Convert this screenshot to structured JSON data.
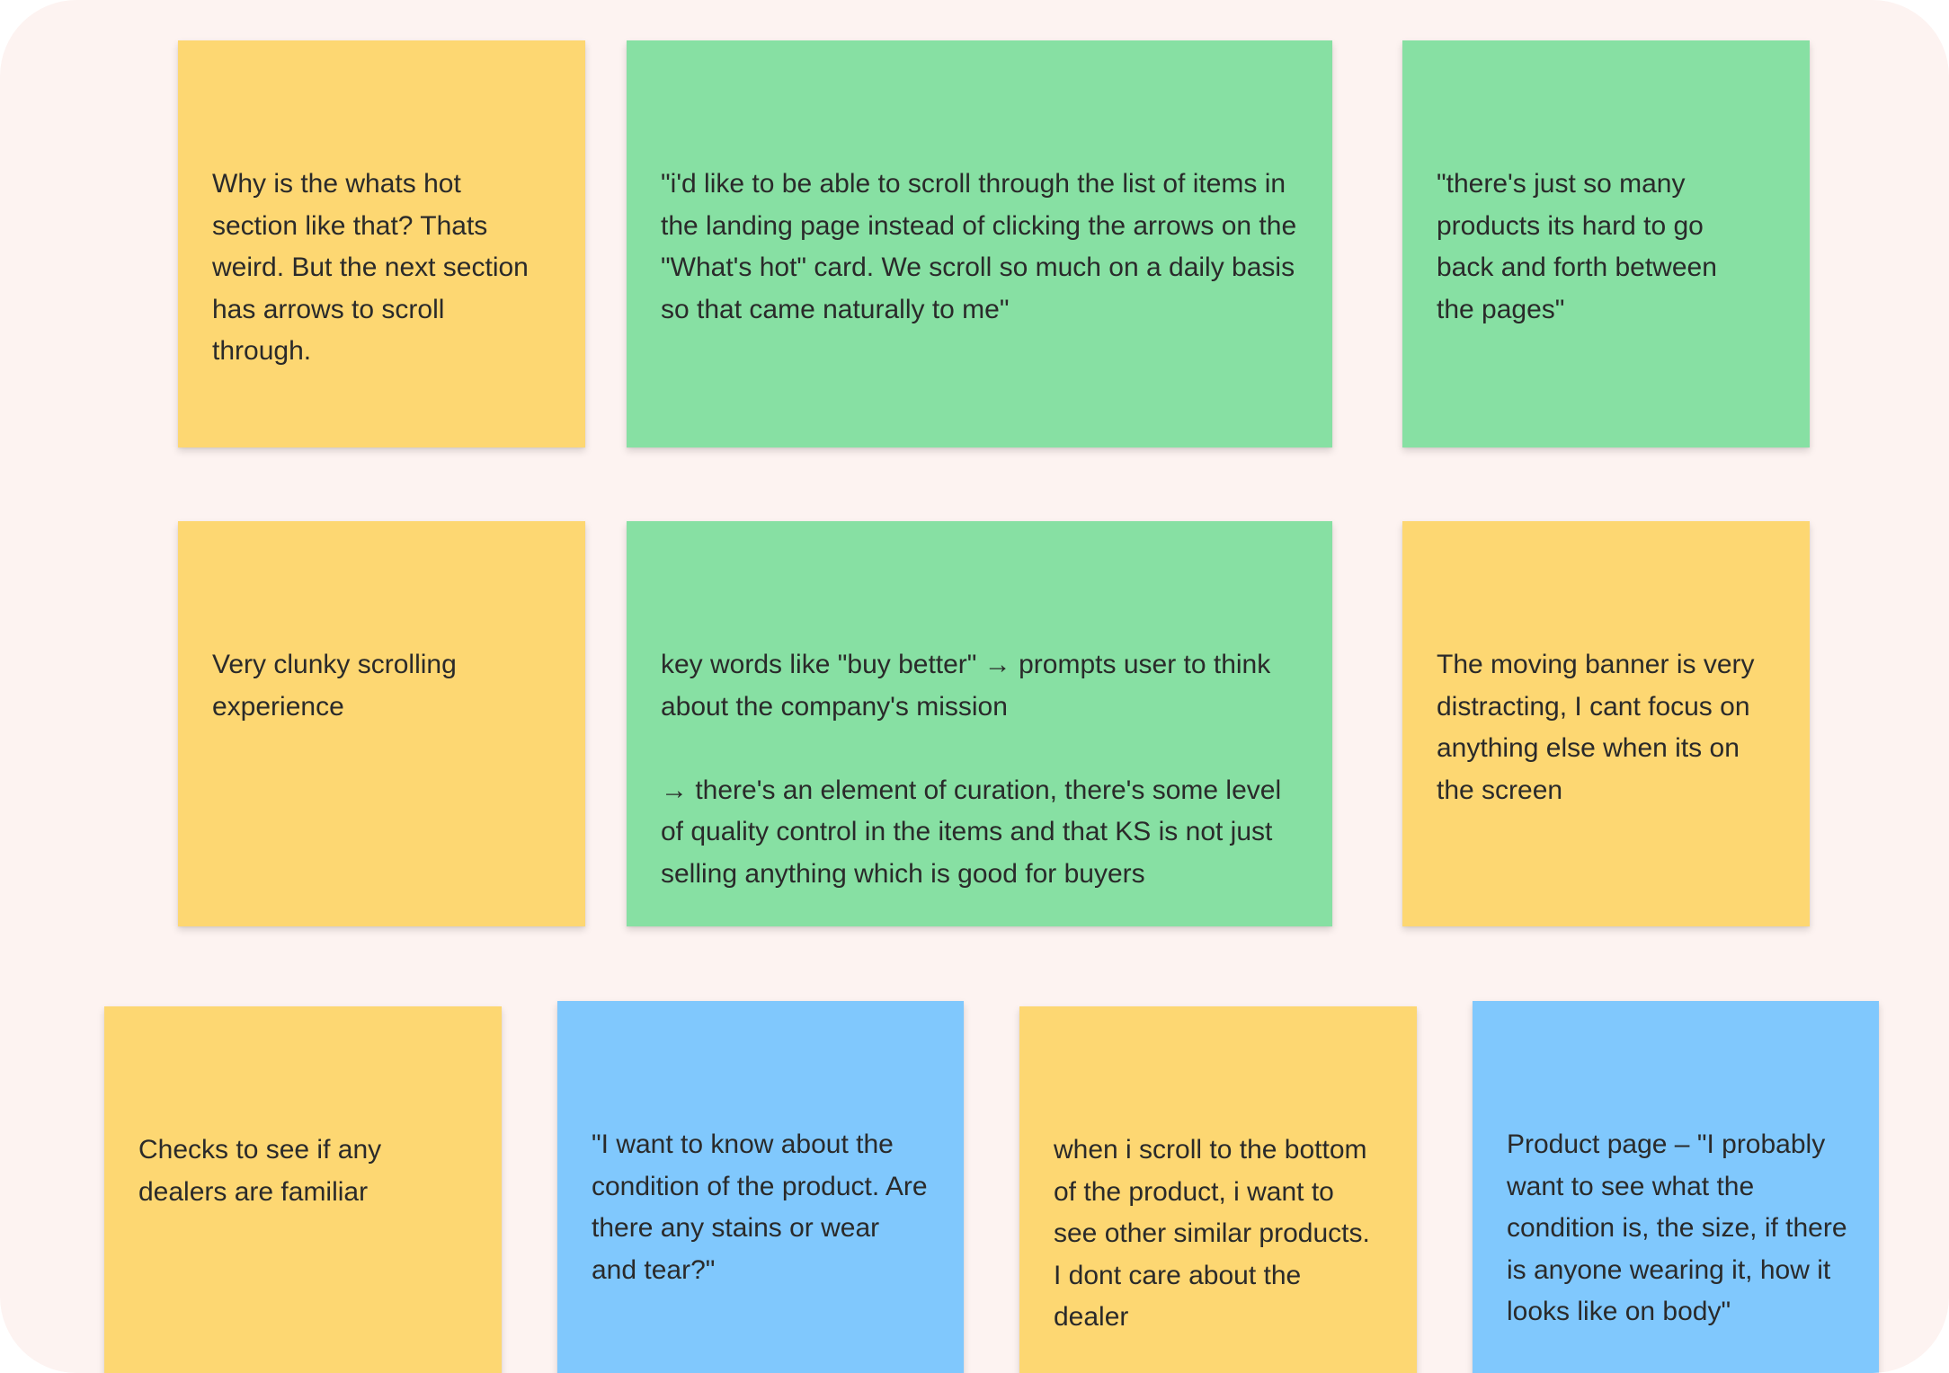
{
  "colors": {
    "background": "#fdf3f1",
    "yellow": "#fdd772",
    "green": "#87e0a3",
    "blue": "#80c8fd"
  },
  "notes": [
    {
      "color": "yellow",
      "text": "Why is the whats hot section like that? Thats weird. But the next section has arrows to scroll through."
    },
    {
      "color": "green",
      "text": "\"i'd like to be able to scroll through the list of items in the landing page instead of clicking the arrows on the \"What's hot\" card. We scroll so much on a daily basis so that came naturally to me\""
    },
    {
      "color": "green",
      "text": "\"there's just so many products its hard to go back and forth between the pages\""
    },
    {
      "color": "yellow",
      "text": "Very clunky scrolling experience"
    },
    {
      "color": "green",
      "text": "key words like \"buy better\" → prompts user to think about the company's mission\n\n→ there's an element of curation, there's some level of quality control in the items and that KS is not just selling anything which is good for buyers"
    },
    {
      "color": "yellow",
      "text": "The moving banner is very distracting, I cant focus on anything else when its on the screen"
    },
    {
      "color": "yellow",
      "text": "Checks to see if any dealers are familiar"
    },
    {
      "color": "blue",
      "text": "\"I want to know about the condition of the product. Are there any stains or wear and tear?\""
    },
    {
      "color": "yellow",
      "text": "when i scroll to the bottom of the product, i want to see other similar products. I dont care about the dealer"
    },
    {
      "color": "blue",
      "text": "Product page – \"I probably want to see what the condition is, the size, if there is anyone wearing it, how it looks like on body\""
    }
  ]
}
